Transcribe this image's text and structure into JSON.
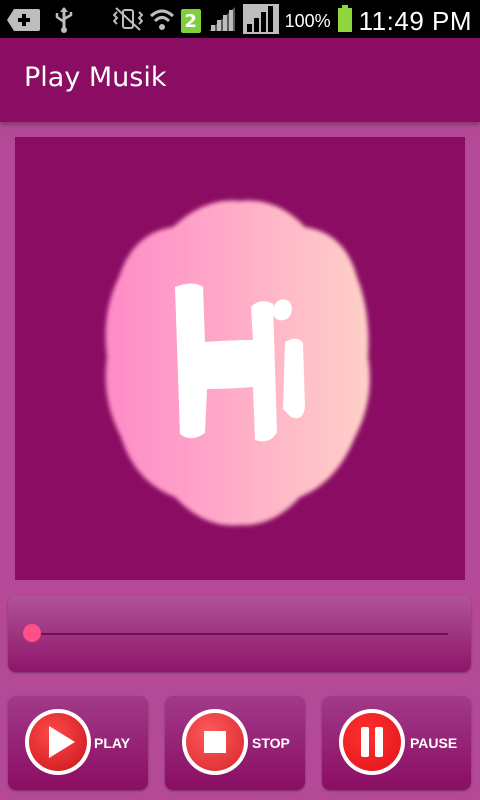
{
  "status_bar": {
    "notification_count": "2",
    "battery_percent": "100%",
    "time": "11:49 PM"
  },
  "action_bar": {
    "title": "Play Musik"
  },
  "album_art": {
    "text": "Hi",
    "background_color": "#8a0d63",
    "gradient_colors": [
      "#ff8ac8",
      "#ffd0c8"
    ]
  },
  "seek_bar": {
    "progress": 0.0
  },
  "controls": {
    "play_label": "PLAY",
    "stop_label": "STOP",
    "pause_label": "PAUSE"
  },
  "colors": {
    "primary": "#8a0d63",
    "background": "#b44a97",
    "accent": "#ff4f87",
    "button_red": "#e8242a"
  }
}
